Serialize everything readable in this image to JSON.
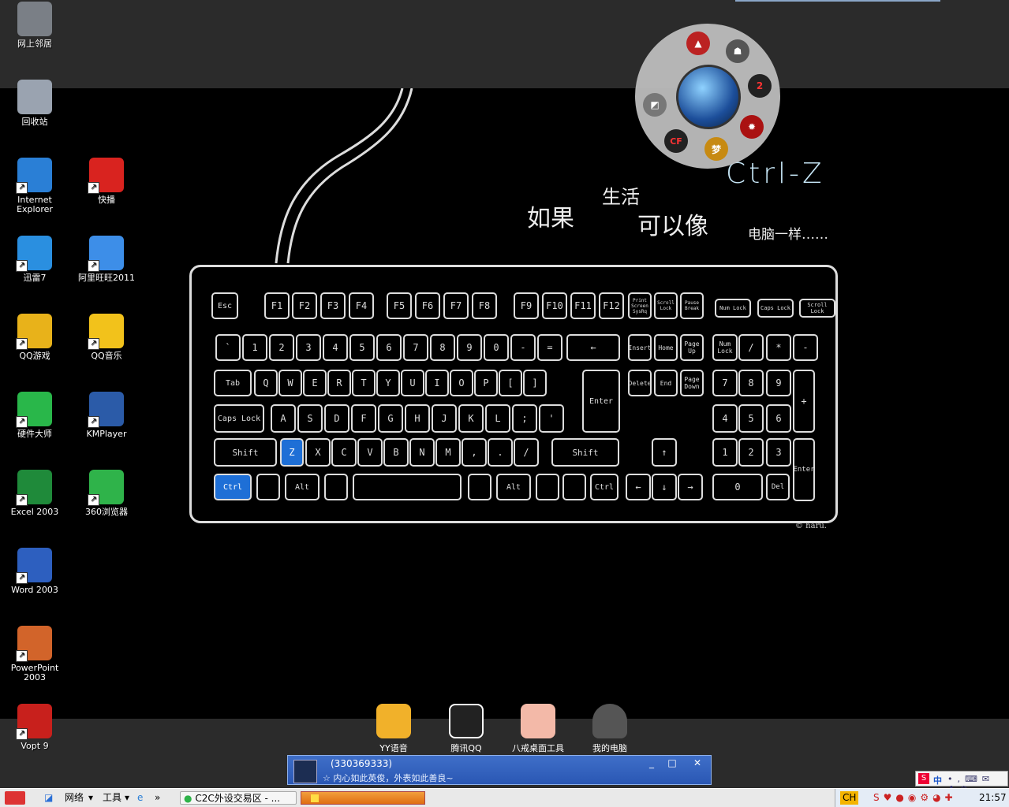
{
  "desktop_icons": [
    {
      "label": "网上邻居",
      "color": "#7a7f86"
    },
    {
      "label": "回收站",
      "color": "#9aa3b0"
    },
    {
      "label": "Internet Explorer",
      "color": "#2a7fd6"
    },
    {
      "label": "快播",
      "color": "#d9231f"
    },
    {
      "label": "迅雷7",
      "color": "#2a8fe0"
    },
    {
      "label": "阿里旺旺2011",
      "color": "#3d8ee8"
    },
    {
      "label": "QQ游戏",
      "color": "#e8b21a"
    },
    {
      "label": "QQ音乐",
      "color": "#f2c21b"
    },
    {
      "label": "硬件大师",
      "color": "#29b74a"
    },
    {
      "label": "KMPlayer",
      "color": "#2b5ba8"
    },
    {
      "label": "Excel 2003",
      "color": "#1f8a3a"
    },
    {
      "label": "360浏览器",
      "color": "#2fb34a"
    },
    {
      "label": "Word 2003",
      "color": "#2d5fbf"
    },
    {
      "label": "PowerPoint 2003",
      "color": "#d2642a"
    },
    {
      "label": "Vopt 9",
      "color": "#c8201c"
    }
  ],
  "wallpaper": {
    "title": "Ctrl-Z",
    "line1": "如果",
    "line1b": "生活",
    "line2": "可以像",
    "line3": "电脑一样……",
    "credit": "© haru."
  },
  "keyboard": {
    "row_f": [
      "Esc",
      "F1",
      "F2",
      "F3",
      "F4",
      "F5",
      "F6",
      "F7",
      "F8",
      "F9",
      "F10",
      "F11",
      "F12",
      "Print Screen SysRq",
      "Scroll Lock",
      "Pause Break"
    ],
    "row_num": [
      "`",
      "1",
      "2",
      "3",
      "4",
      "5",
      "6",
      "7",
      "8",
      "9",
      "0",
      "-",
      "=",
      "←"
    ],
    "row_q": [
      "Tab",
      "Q",
      "W",
      "E",
      "R",
      "T",
      "Y",
      "U",
      "I",
      "O",
      "P",
      "[",
      "]"
    ],
    "row_a": [
      "Caps Lock",
      "A",
      "S",
      "D",
      "F",
      "G",
      "H",
      "J",
      "K",
      "L",
      ";",
      "'",
      "Enter"
    ],
    "row_z": [
      "Shift",
      "Z",
      "X",
      "C",
      "V",
      "B",
      "N",
      "M",
      ",",
      ".",
      "/",
      "Shift"
    ],
    "row_b": [
      "Ctrl",
      "Alt",
      "Alt",
      "Ctrl"
    ],
    "nav1": [
      "Insert",
      "Home",
      "Page Up"
    ],
    "nav2": [
      "Delete",
      "End",
      "Page Down"
    ],
    "arrows": [
      "↑",
      "←",
      "↓",
      "→"
    ],
    "leds": [
      "Num Lock",
      "Caps Lock",
      "Scroll Lock"
    ],
    "numpad_top": [
      "Num Lock",
      "/",
      "*",
      "-"
    ],
    "numpad": [
      "7",
      "8",
      "9",
      "+",
      "4",
      "5",
      "6",
      "1",
      "2",
      "3",
      "Enter",
      "0",
      "Del"
    ]
  },
  "launcher": {
    "items": [
      "2",
      "4",
      "CF",
      "梦"
    ]
  },
  "dock": [
    {
      "label": "YY语音",
      "color": "#f1b12a"
    },
    {
      "label": "腾讯QQ",
      "color": "#222222"
    },
    {
      "label": "八戒桌面工具",
      "color": "#f3b9a8"
    },
    {
      "label": "我的电脑",
      "color": "#555555"
    }
  ],
  "notification": {
    "name": "(330369333)",
    "message": "内心如此英俊，外表如此善良~",
    "min": "_",
    "max": "□",
    "close": "✕"
  },
  "taskbar": {
    "network": "网络",
    "tools": "工具",
    "window": "C2C外设交易区 - ...",
    "time": "21:57",
    "lang": "CH"
  },
  "ime": {
    "label": "中"
  }
}
